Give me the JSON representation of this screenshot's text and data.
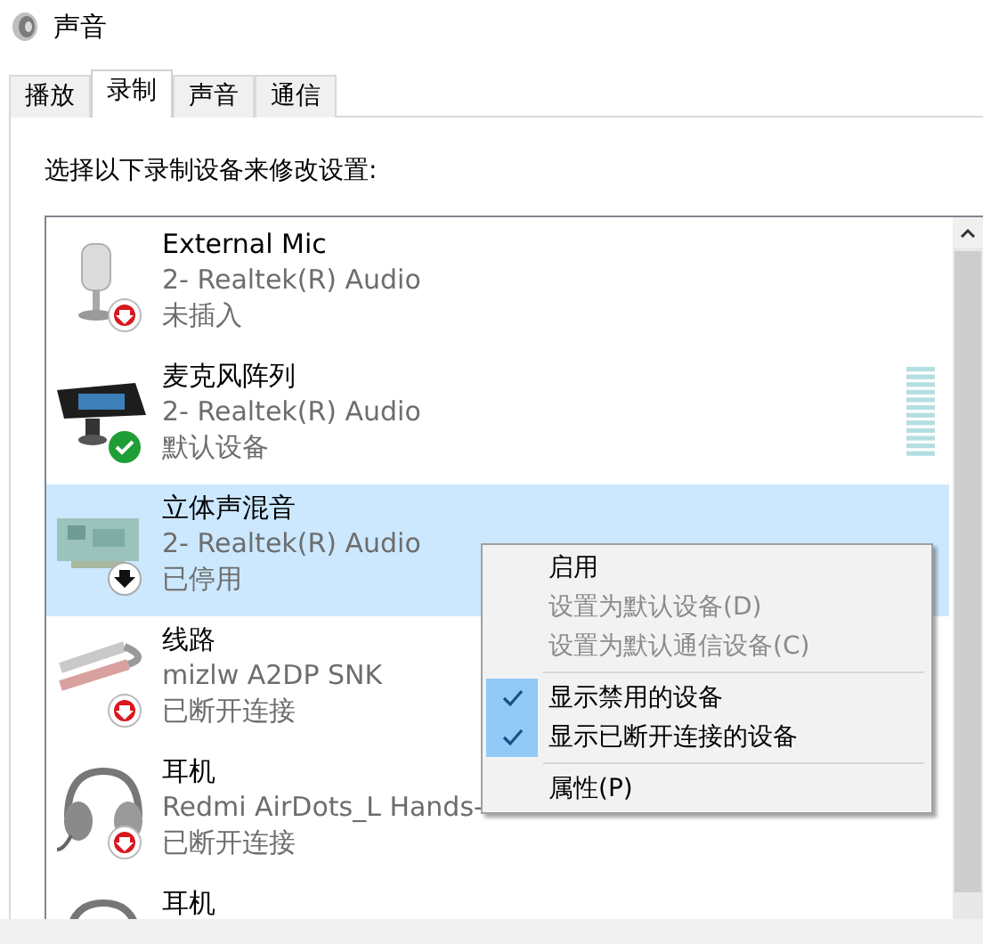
{
  "window": {
    "title": "声音"
  },
  "tabs": [
    {
      "label": "播放",
      "selected": false
    },
    {
      "label": "录制",
      "selected": true
    },
    {
      "label": "声音",
      "selected": false
    },
    {
      "label": "通信",
      "selected": false
    }
  ],
  "instruction": "选择以下录制设备来修改设置:",
  "devices": [
    {
      "name": "External Mic",
      "driver": "2- Realtek(R) Audio",
      "status": "未插入",
      "kind": "mic",
      "badge": {
        "kind": "unplugged"
      },
      "selected": false
    },
    {
      "name": "麦克风阵列",
      "driver": "2- Realtek(R) Audio",
      "status": "默认设备",
      "kind": "array",
      "badge": {
        "kind": "default"
      },
      "selected": false,
      "level": 0
    },
    {
      "name": "立体声混音",
      "driver": "2- Realtek(R) Audio",
      "status": "已停用",
      "kind": "card",
      "badge": {
        "kind": "disabled"
      },
      "selected": true
    },
    {
      "name": "线路",
      "driver": "mizlw A2DP SNK",
      "status": "已断开连接",
      "kind": "line",
      "badge": {
        "kind": "unplugged"
      },
      "selected": false
    },
    {
      "name": "耳机",
      "driver": "Redmi AirDots_L Hands-",
      "status": "已断开连接",
      "kind": "headset",
      "badge": {
        "kind": "unplugged"
      },
      "selected": false
    },
    {
      "name": "耳机",
      "kind": "headset",
      "selected": false
    }
  ],
  "context_menu": [
    {
      "label": "启用",
      "disabled": false,
      "checked": false
    },
    {
      "label": "设置为默认设备(D)",
      "disabled": true,
      "checked": false
    },
    {
      "label": "设置为默认通信设备(C)",
      "disabled": true,
      "checked": false
    },
    {
      "kind": "separator"
    },
    {
      "label": "显示禁用的设备",
      "disabled": false,
      "checked": true
    },
    {
      "label": "显示已断开连接的设备",
      "disabled": false,
      "checked": true
    },
    {
      "kind": "separator"
    },
    {
      "label": "属性(P)",
      "disabled": false,
      "checked": false
    }
  ]
}
